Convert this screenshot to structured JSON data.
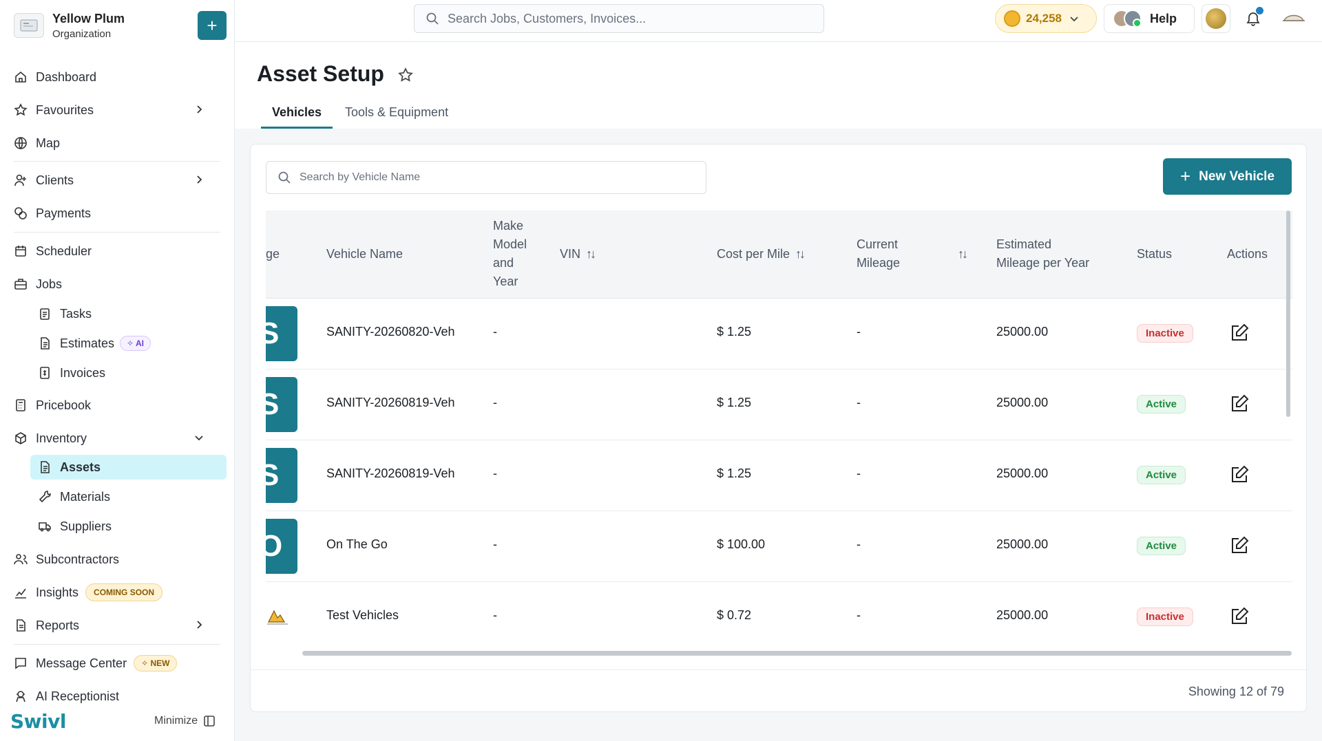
{
  "org": {
    "name": "Yellow Plum",
    "subtitle": "Organization",
    "add_label": "+"
  },
  "nav": {
    "dashboard": "Dashboard",
    "favourites": "Favourites",
    "map": "Map",
    "clients": "Clients",
    "payments": "Payments",
    "scheduler": "Scheduler",
    "jobs": "Jobs",
    "tasks": "Tasks",
    "estimates": "Estimates",
    "estimates_badge": "✧ AI",
    "invoices": "Invoices",
    "pricebook": "Pricebook",
    "inventory": "Inventory",
    "assets": "Assets",
    "materials": "Materials",
    "suppliers": "Suppliers",
    "subcontractors": "Subcontractors",
    "insights": "Insights",
    "insights_badge": "COMING SOON",
    "reports": "Reports",
    "message_center": "Message Center",
    "message_badge": "✧ NEW",
    "ai_receptionist": "AI Receptionist"
  },
  "brand": "Swivl",
  "minimize_label": "Minimize",
  "topbar": {
    "search_placeholder": "Search Jobs, Customers, Invoices...",
    "points": "24,258",
    "help": "Help"
  },
  "page": {
    "title": "Asset Setup",
    "tabs": [
      "Vehicles",
      "Tools & Equipment"
    ],
    "vehicle_search_placeholder": "Search by Vehicle Name",
    "new_vehicle": "New Vehicle"
  },
  "table": {
    "columns": {
      "image": "ge",
      "name": "Vehicle Name",
      "make_1": "Make",
      "make_2": "Model",
      "make_3": "and",
      "make_4": "Year",
      "vin": "VIN",
      "cost": "Cost per Mile",
      "mileage_1": "Current",
      "mileage_2": "Mileage",
      "estimated_1": "Estimated",
      "estimated_2": "Mileage per Year",
      "status": "Status",
      "actions": "Actions"
    },
    "rows": [
      {
        "thumb": "S",
        "name": "SANITY-20260820-Veh",
        "make": "-",
        "cost": "$ 1.25",
        "mileage": "-",
        "estimated": "25000.00",
        "status": "Inactive"
      },
      {
        "thumb": "S",
        "name": "SANITY-20260819-Veh",
        "make": "-",
        "cost": "$ 1.25",
        "mileage": "-",
        "estimated": "25000.00",
        "status": "Active"
      },
      {
        "thumb": "S",
        "name": "SANITY-20260819-Veh",
        "make": "-",
        "cost": "$ 1.25",
        "mileage": "-",
        "estimated": "25000.00",
        "status": "Active"
      },
      {
        "thumb": "O",
        "name": "On The Go",
        "make": "-",
        "cost": "$ 100.00",
        "mileage": "-",
        "estimated": "25000.00",
        "status": "Active"
      },
      {
        "thumb": "",
        "name": "Test Vehicles",
        "make": "-",
        "cost": "$ 0.72",
        "mileage": "-",
        "estimated": "25000.00",
        "status": "Inactive"
      }
    ],
    "showing": "Showing 12 of 79"
  },
  "colors": {
    "accent": "#1b7a8c",
    "active_nav": "#cff5fb"
  }
}
